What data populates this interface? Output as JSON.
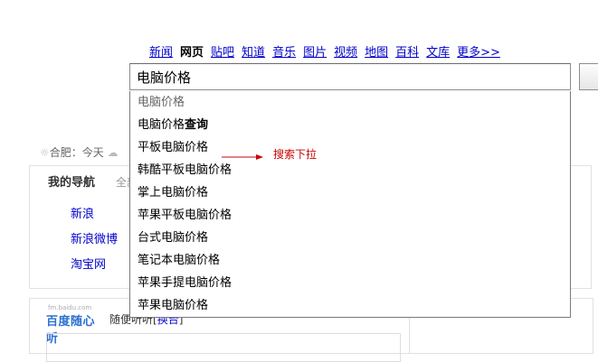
{
  "nav": {
    "items": [
      {
        "label": "新闻",
        "current": false
      },
      {
        "label": "网页",
        "current": true
      },
      {
        "label": "贴吧",
        "current": false
      },
      {
        "label": "知道",
        "current": false
      },
      {
        "label": "音乐",
        "current": false
      },
      {
        "label": "图片",
        "current": false
      },
      {
        "label": "视频",
        "current": false
      },
      {
        "label": "地图",
        "current": false
      },
      {
        "label": "百科",
        "current": false
      },
      {
        "label": "文库",
        "current": false
      },
      {
        "label": "更多>>",
        "current": false
      }
    ]
  },
  "search": {
    "value": "电脑价格"
  },
  "suggestions": {
    "first": "电脑价格",
    "items": [
      {
        "pre": "电脑价格",
        "bold": "查询"
      },
      {
        "pre": "平板电脑价格",
        "bold": ""
      },
      {
        "pre": "韩酷平板电脑价格",
        "bold": ""
      },
      {
        "pre": "掌上电脑价格",
        "bold": ""
      },
      {
        "pre": "苹果平板电脑价格",
        "bold": ""
      },
      {
        "pre": "台式电脑价格",
        "bold": ""
      },
      {
        "pre": "笔记本电脑价格",
        "bold": ""
      },
      {
        "pre": "苹果手提电脑价格",
        "bold": ""
      },
      {
        "pre": "苹果电脑价格",
        "bold": ""
      }
    ]
  },
  "annotation": {
    "text": "搜索下拉"
  },
  "weather": {
    "text": "合肥：今天"
  },
  "my_nav": {
    "title": "我的导航",
    "all": "全部",
    "links": [
      "新浪",
      "新浪微博",
      "淘宝网"
    ]
  },
  "radio": {
    "logo_small": "fm.baidu.com",
    "logo_big": "百度随心听",
    "random_prefix": "随便听听[",
    "random_link": "换台",
    "random_suffix": "]"
  },
  "colors": {
    "link": "#0000cc",
    "annotation": "#cc0000",
    "logo_red": "#dd1f1f",
    "logo_blue": "#2a4fd6"
  }
}
